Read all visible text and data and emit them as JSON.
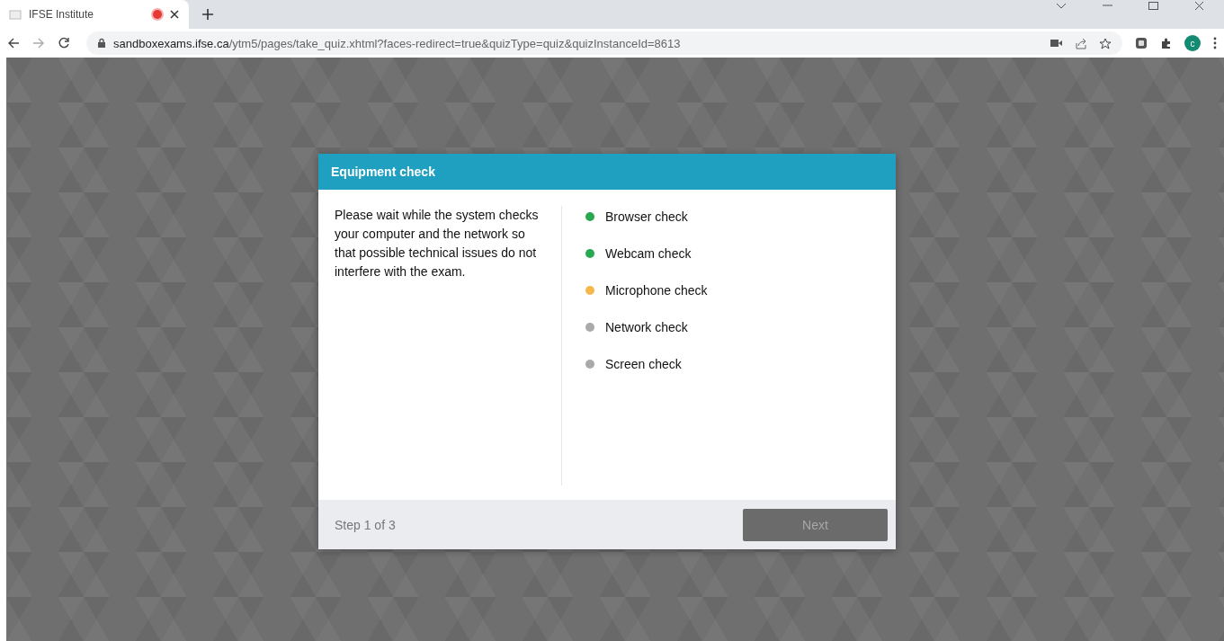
{
  "browser": {
    "tab": {
      "title": "IFSE Institute",
      "recording": true
    },
    "address": {
      "host": "sandboxexams.ifse.ca",
      "path": "/ytm5/pages/take_quiz.xhtml?faces-redirect=true&quizType=quiz&quizInstanceId=8613"
    },
    "profile_initial": "c"
  },
  "dialog": {
    "title": "Equipment check",
    "message": "Please wait while the system checks your computer and the network so that possible technical issues do not interfere with the exam.",
    "checks": [
      {
        "label": "Browser check",
        "color": "#27a851"
      },
      {
        "label": "Webcam check",
        "color": "#27a851"
      },
      {
        "label": "Microphone check",
        "color": "#f7b84b"
      },
      {
        "label": "Network check",
        "color": "#aaaaaa"
      },
      {
        "label": "Screen check",
        "color": "#aaaaaa"
      }
    ],
    "step": "Step 1 of 3",
    "next_button": {
      "label": "Next",
      "disabled": true
    }
  }
}
